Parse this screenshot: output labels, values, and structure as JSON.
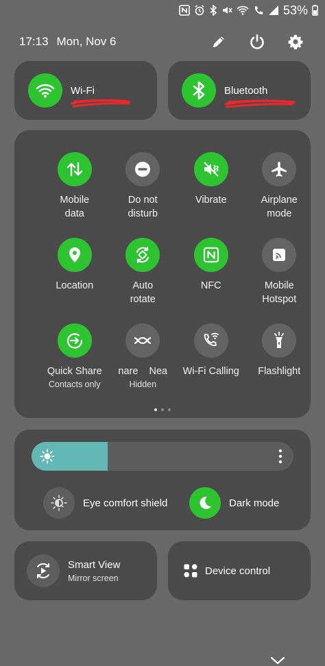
{
  "status": {
    "battery": "53%"
  },
  "header": {
    "time": "17:13",
    "date": "Mon, Nov 6"
  },
  "connections": [
    {
      "label": "Wi-Fi",
      "icon": "wifi-icon",
      "active": true
    },
    {
      "label": "Bluetooth",
      "icon": "bluetooth-icon",
      "active": true
    }
  ],
  "tiles": [
    {
      "label": "Mobile\ndata",
      "icon": "mobile-data-icon",
      "active": true
    },
    {
      "label": "Do not\ndisturb",
      "icon": "do-not-disturb-icon",
      "active": false
    },
    {
      "label": "Vibrate",
      "icon": "vibrate-icon",
      "active": true
    },
    {
      "label": "Airplane\nmode",
      "icon": "airplane-icon",
      "active": false
    },
    {
      "label": "Location",
      "icon": "location-icon",
      "active": true
    },
    {
      "label": "Auto\nrotate",
      "icon": "auto-rotate-icon",
      "active": true
    },
    {
      "label": "NFC",
      "icon": "nfc-icon",
      "active": true
    },
    {
      "label": "Mobile\nHotspot",
      "icon": "hotspot-icon",
      "active": false
    },
    {
      "label": "Quick Share",
      "sub": "Contacts only",
      "icon": "quick-share-icon",
      "active": true
    },
    {
      "label": "nare    Nea",
      "sub": "Hidden",
      "icon": "nearby-share-icon",
      "active": false
    },
    {
      "label": "Wi-Fi Calling",
      "icon": "wifi-calling-icon",
      "active": false
    },
    {
      "label": "Flashlight",
      "icon": "flashlight-icon",
      "active": false
    }
  ],
  "brightness": {
    "level": 0.29
  },
  "toggles": [
    {
      "label": "Eye comfort shield",
      "icon": "eye-comfort-icon",
      "active": false
    },
    {
      "label": "Dark mode",
      "icon": "dark-mode-icon",
      "active": true
    }
  ],
  "bottom": [
    {
      "title": "Smart View",
      "sub": "Mirror screen",
      "icon": "smart-view-icon"
    },
    {
      "title": "Device control",
      "icon": "device-control-icon"
    }
  ],
  "colors": {
    "active": "#2ec431",
    "inactive": "#636363",
    "panel": "#4a4a4a",
    "background": "#686868",
    "brightness_fill": "#63b7b5"
  }
}
